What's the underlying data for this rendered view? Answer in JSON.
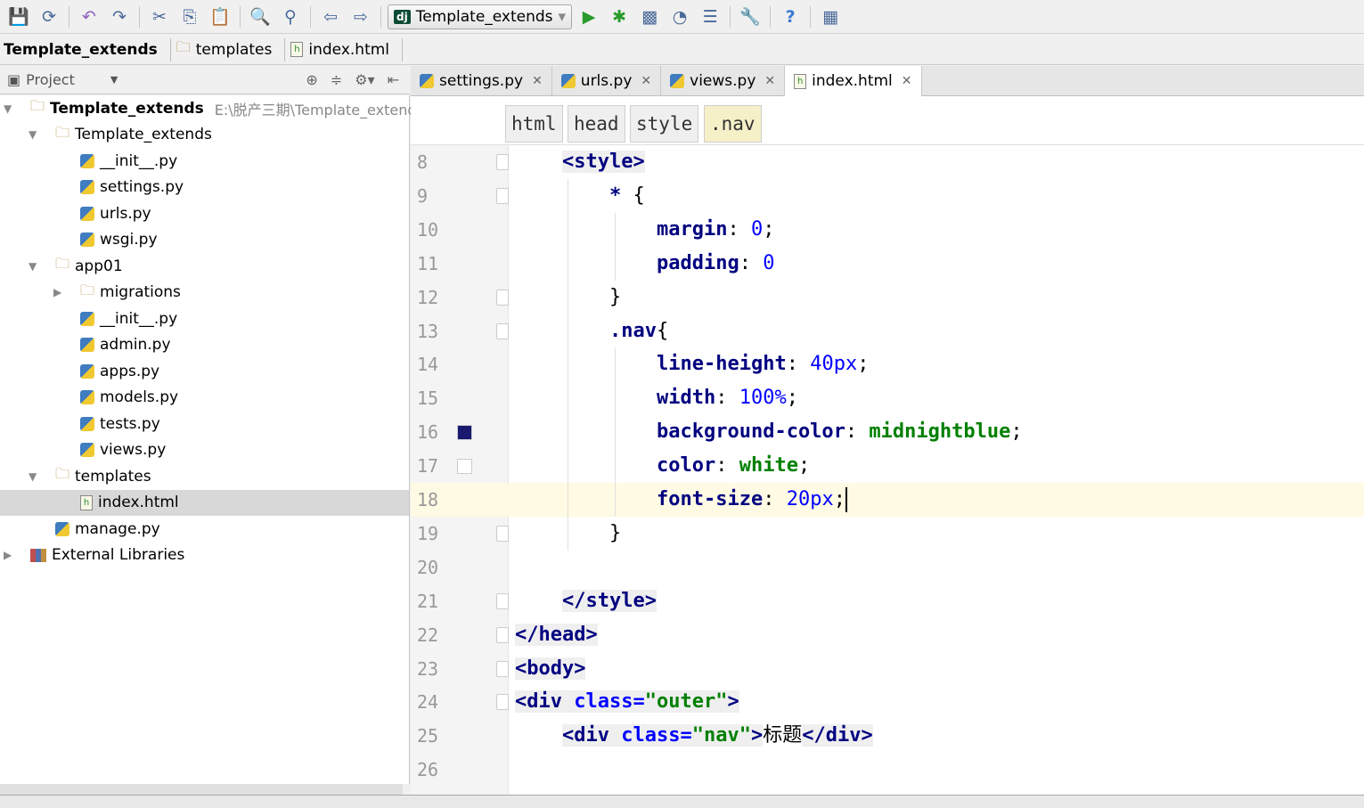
{
  "toolbar": {
    "run_config": "Template_extends",
    "icons": [
      "save-icon",
      "sync-icon",
      "undo-icon",
      "redo-icon",
      "cut-icon",
      "copy-icon",
      "paste-icon",
      "find-icon",
      "replace-icon",
      "back-icon",
      "forward-icon",
      "run-icon",
      "debug-icon",
      "coverage-icon",
      "profile-icon",
      "build-icon",
      "settings-icon",
      "help-icon",
      "sdk-icon"
    ]
  },
  "breadcrumbs": [
    "Template_extends",
    "templates",
    "index.html"
  ],
  "project": {
    "title": "Project",
    "tree": [
      {
        "label": "Template_extends",
        "path": "E:\\脱产三期\\Template_extends",
        "type": "folder",
        "level": 0,
        "expanded": true,
        "bold": true
      },
      {
        "label": "Template_extends",
        "type": "folder",
        "level": 1,
        "expanded": true
      },
      {
        "label": "__init__.py",
        "type": "py",
        "level": 2
      },
      {
        "label": "settings.py",
        "type": "py",
        "level": 2
      },
      {
        "label": "urls.py",
        "type": "py",
        "level": 2
      },
      {
        "label": "wsgi.py",
        "type": "py",
        "level": 2
      },
      {
        "label": "app01",
        "type": "folder",
        "level": 1,
        "expanded": true
      },
      {
        "label": "migrations",
        "type": "folder",
        "level": 2,
        "expanded": false
      },
      {
        "label": "__init__.py",
        "type": "py",
        "level": 2
      },
      {
        "label": "admin.py",
        "type": "py",
        "level": 2
      },
      {
        "label": "apps.py",
        "type": "py",
        "level": 2
      },
      {
        "label": "models.py",
        "type": "py",
        "level": 2
      },
      {
        "label": "tests.py",
        "type": "py",
        "level": 2
      },
      {
        "label": "views.py",
        "type": "py",
        "level": 2
      },
      {
        "label": "templates",
        "type": "folder",
        "level": 1,
        "expanded": true
      },
      {
        "label": "index.html",
        "type": "html",
        "level": 2,
        "selected": true
      },
      {
        "label": "manage.py",
        "type": "py",
        "level": 1
      },
      {
        "label": "External Libraries",
        "type": "lib",
        "level": 0,
        "expanded": false
      }
    ]
  },
  "tabs": [
    {
      "label": "settings.py",
      "type": "py"
    },
    {
      "label": "urls.py",
      "type": "py"
    },
    {
      "label": "views.py",
      "type": "py"
    },
    {
      "label": "index.html",
      "type": "html",
      "active": true
    }
  ],
  "editor_breadcrumbs": [
    "html",
    "head",
    "style",
    ".nav"
  ],
  "code": [
    {
      "n": "8",
      "indent": 1,
      "fold": true,
      "tokens": [
        [
          "t-tag t-tagbg",
          "<style>"
        ]
      ]
    },
    {
      "n": "9",
      "indent": 2,
      "fold": true,
      "tokens": [
        [
          "t-sel",
          "* "
        ],
        [
          "t-plain",
          "{"
        ]
      ]
    },
    {
      "n": "10",
      "indent": 3,
      "tokens": [
        [
          "t-prop",
          "margin"
        ],
        [
          "t-plain",
          ": "
        ],
        [
          "t-num",
          "0"
        ],
        [
          "t-plain",
          ";"
        ]
      ]
    },
    {
      "n": "11",
      "indent": 3,
      "tokens": [
        [
          "t-prop",
          "padding"
        ],
        [
          "t-plain",
          ": "
        ],
        [
          "t-num",
          "0"
        ]
      ]
    },
    {
      "n": "12",
      "indent": 2,
      "fold": true,
      "tokens": [
        [
          "t-plain",
          "}"
        ]
      ]
    },
    {
      "n": "13",
      "indent": 2,
      "fold": true,
      "tokens": [
        [
          "t-sel",
          ".nav"
        ],
        [
          "t-plain",
          "{"
        ]
      ]
    },
    {
      "n": "14",
      "indent": 3,
      "tokens": [
        [
          "t-prop",
          "line-height"
        ],
        [
          "t-plain",
          ": "
        ],
        [
          "t-num",
          "40px"
        ],
        [
          "t-plain",
          ";"
        ]
      ]
    },
    {
      "n": "15",
      "indent": 3,
      "tokens": [
        [
          "t-prop",
          "width"
        ],
        [
          "t-plain",
          ": "
        ],
        [
          "t-num",
          "100%"
        ],
        [
          "t-plain",
          ";"
        ]
      ]
    },
    {
      "n": "16",
      "indent": 3,
      "swatch": "#191970",
      "tokens": [
        [
          "t-prop",
          "background-color"
        ],
        [
          "t-plain",
          ": "
        ],
        [
          "t-kw",
          "midnightblue"
        ],
        [
          "t-plain",
          ";"
        ]
      ]
    },
    {
      "n": "17",
      "indent": 3,
      "swatch": "#ffffff",
      "tokens": [
        [
          "t-prop",
          "color"
        ],
        [
          "t-plain",
          ": "
        ],
        [
          "t-kw",
          "white"
        ],
        [
          "t-plain",
          ";"
        ]
      ]
    },
    {
      "n": "18",
      "indent": 3,
      "current": true,
      "tokens": [
        [
          "t-prop",
          "font-size"
        ],
        [
          "t-plain",
          ": "
        ],
        [
          "t-num",
          "20px"
        ],
        [
          "t-plain",
          ";"
        ]
      ]
    },
    {
      "n": "19",
      "indent": 2,
      "fold": true,
      "tokens": [
        [
          "t-plain",
          "}"
        ]
      ]
    },
    {
      "n": "20",
      "indent": 0,
      "tokens": []
    },
    {
      "n": "21",
      "indent": 1,
      "fold": true,
      "tokens": [
        [
          "t-tag t-tagbg",
          "</style>"
        ]
      ]
    },
    {
      "n": "22",
      "indent": 0,
      "fold": true,
      "tokens": [
        [
          "t-tag t-tagbg",
          "</head>"
        ]
      ]
    },
    {
      "n": "23",
      "indent": 0,
      "fold": true,
      "tokens": [
        [
          "t-tag t-tagbg",
          "<body>"
        ]
      ]
    },
    {
      "n": "24",
      "indent": 0,
      "fold": true,
      "tokens": [
        [
          "t-tag t-tagbg",
          "<div "
        ],
        [
          "t-attr t-tagbg",
          "class="
        ],
        [
          "t-str t-tagbg",
          "\"outer\""
        ],
        [
          "t-tag t-tagbg",
          ">"
        ]
      ]
    },
    {
      "n": "25",
      "indent": 1,
      "tokens": [
        [
          "t-tag t-tagbg",
          "<div "
        ],
        [
          "t-attr t-tagbg",
          "class="
        ],
        [
          "t-str t-tagbg",
          "\"nav\""
        ],
        [
          "t-tag t-tagbg",
          ">"
        ],
        [
          "t-plain",
          "标题"
        ],
        [
          "t-tag t-tagbg",
          "</div>"
        ]
      ]
    },
    {
      "n": "26",
      "indent": 0,
      "tokens": []
    }
  ]
}
